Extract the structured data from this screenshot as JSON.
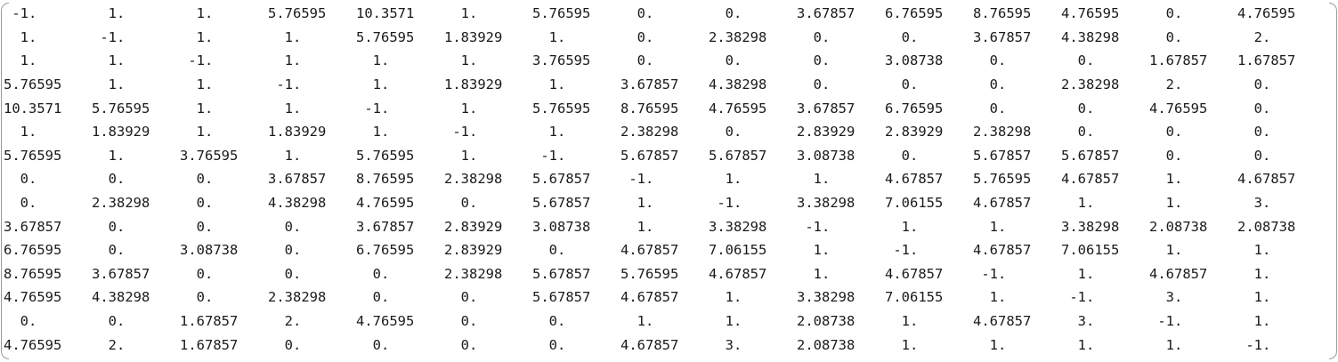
{
  "matrix": {
    "rows": [
      [
        " -1.",
        "  1.",
        "  1.",
        "5.76595",
        "10.3571",
        "  1.",
        "5.76595",
        "  0.",
        "  0.",
        "3.67857",
        "6.76595",
        "8.76595",
        "4.76595",
        "  0.",
        "4.76595"
      ],
      [
        "  1.",
        " -1.",
        "  1.",
        "  1.",
        "5.76595",
        "1.83929",
        "  1.",
        "  0.",
        "2.38298",
        "  0.",
        "  0.",
        "3.67857",
        "4.38298",
        "  0.",
        "  2."
      ],
      [
        "  1.",
        "  1.",
        " -1.",
        "  1.",
        "  1.",
        "  1.",
        "3.76595",
        "  0.",
        "  0.",
        "  0.",
        "3.08738",
        "  0.",
        "  0.",
        "1.67857",
        "1.67857"
      ],
      [
        "5.76595",
        "  1.",
        "  1.",
        " -1.",
        "  1.",
        "1.83929",
        "  1.",
        "3.67857",
        "4.38298",
        "  0.",
        "  0.",
        "  0.",
        "2.38298",
        "  2.",
        "  0."
      ],
      [
        "10.3571",
        "5.76595",
        "  1.",
        "  1.",
        " -1.",
        "  1.",
        "5.76595",
        "8.76595",
        "4.76595",
        "3.67857",
        "6.76595",
        "  0.",
        "  0.",
        "4.76595",
        "  0."
      ],
      [
        "  1.",
        "1.83929",
        "  1.",
        "1.83929",
        "  1.",
        " -1.",
        "  1.",
        "2.38298",
        "  0.",
        "2.83929",
        "2.83929",
        "2.38298",
        "  0.",
        "  0.",
        "  0."
      ],
      [
        "5.76595",
        "  1.",
        "3.76595",
        "  1.",
        "5.76595",
        "  1.",
        " -1.",
        "5.67857",
        "5.67857",
        "3.08738",
        "  0.",
        "5.67857",
        "5.67857",
        "  0.",
        "  0."
      ],
      [
        "  0.",
        "  0.",
        "  0.",
        "3.67857",
        "8.76595",
        "2.38298",
        "5.67857",
        " -1.",
        "  1.",
        "  1.",
        "4.67857",
        "5.76595",
        "4.67857",
        "  1.",
        "4.67857"
      ],
      [
        "  0.",
        "2.38298",
        "  0.",
        "4.38298",
        "4.76595",
        "  0.",
        "5.67857",
        "  1.",
        " -1.",
        "3.38298",
        "7.06155",
        "4.67857",
        "  1.",
        "  1.",
        "  3."
      ],
      [
        "3.67857",
        "  0.",
        "  0.",
        "  0.",
        "3.67857",
        "2.83929",
        "3.08738",
        "  1.",
        "3.38298",
        " -1.",
        "  1.",
        "  1.",
        "3.38298",
        "2.08738",
        "2.08738"
      ],
      [
        "6.76595",
        "  0.",
        "3.08738",
        "  0.",
        "6.76595",
        "2.83929",
        "  0.",
        "4.67857",
        "7.06155",
        "  1.",
        " -1.",
        "4.67857",
        "7.06155",
        "  1.",
        "  1."
      ],
      [
        "8.76595",
        "3.67857",
        "  0.",
        "  0.",
        "  0.",
        "2.38298",
        "5.67857",
        "5.76595",
        "4.67857",
        "  1.",
        "4.67857",
        " -1.",
        "  1.",
        "4.67857",
        "  1."
      ],
      [
        "4.76595",
        "4.38298",
        "  0.",
        "2.38298",
        "  0.",
        "  0.",
        "5.67857",
        "4.67857",
        "  1.",
        "3.38298",
        "7.06155",
        "  1.",
        " -1.",
        "  3.",
        "  1."
      ],
      [
        "  0.",
        "  0.",
        "1.67857",
        "  2.",
        "4.76595",
        "  0.",
        "  0.",
        "  1.",
        "  1.",
        "2.08738",
        "  1.",
        "4.67857",
        "  3.",
        " -1.",
        "  1."
      ],
      [
        "4.76595",
        "  2.",
        "1.67857",
        "  0.",
        "  0.",
        "  0.",
        "  0.",
        "4.67857",
        "  3.",
        "2.08738",
        "  1.",
        "  1.",
        "  1.",
        "  1.",
        " -1."
      ]
    ]
  }
}
